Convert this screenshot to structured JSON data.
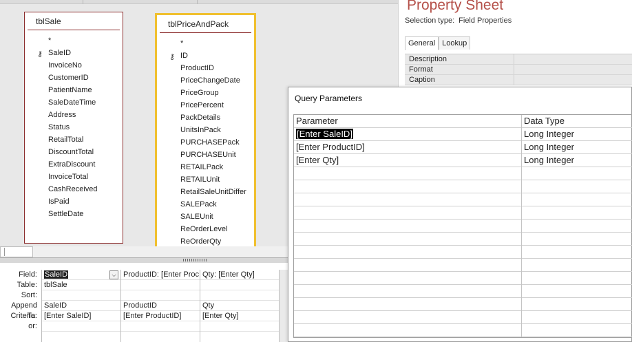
{
  "tables": [
    {
      "title": "tblSale",
      "key_field": "SaleID",
      "fields": [
        "*",
        "SaleID",
        "InvoiceNo",
        "CustomerID",
        "PatientName",
        "SaleDateTime",
        "Address",
        "Status",
        "RetailTotal",
        "DiscountTotal",
        "ExtraDiscount",
        "InvoiceTotal",
        "CashReceived",
        "IsPaid",
        "SettleDate"
      ]
    },
    {
      "title": "tblPriceAndPack",
      "key_field": "ID",
      "fields": [
        "*",
        "ID",
        "ProductID",
        "PriceChangeDate",
        "PriceGroup",
        "PricePercent",
        "PackDetails",
        "UnitsInPack",
        "PURCHASEPack",
        "PURCHASEUnit",
        "RETAILPack",
        "RETAILUnit",
        "RetailSaleUnitDiffer",
        "SALEPack",
        "SALEUnit",
        "ReOrderLevel",
        "ReOrderQty"
      ]
    }
  ],
  "qbe": {
    "row_labels": [
      "Field:",
      "Table:",
      "Sort:",
      "Append To:",
      "Criteria:",
      "or:"
    ],
    "columns": [
      {
        "field": "SaleID",
        "table": "tblSale",
        "sort": "",
        "append_to": "SaleID",
        "criteria": "[Enter SaleID]",
        "or": ""
      },
      {
        "field": "ProductID: [Enter Proc",
        "table": "",
        "sort": "",
        "append_to": "ProductID",
        "criteria": "[Enter ProductID]",
        "or": ""
      },
      {
        "field": "Qty: [Enter Qty]",
        "table": "",
        "sort": "",
        "append_to": "Qty",
        "criteria": "[Enter Qty]",
        "or": ""
      }
    ]
  },
  "property_sheet": {
    "title": "Property Sheet",
    "selection_type_label": "Selection type:",
    "selection_type_value": "Field Properties",
    "tabs": [
      "General",
      "Lookup"
    ],
    "active_tab": "General",
    "properties": [
      "Description",
      "Format",
      "Caption"
    ]
  },
  "dialog": {
    "title": "Query Parameters",
    "headers": [
      "Parameter",
      "Data Type"
    ],
    "rows": [
      {
        "parameter": "[Enter SaleID]",
        "data_type": "Long Integer"
      },
      {
        "parameter": "[Enter ProductID]",
        "data_type": "Long Integer"
      },
      {
        "parameter": "[Enter Qty]",
        "data_type": "Long Integer"
      }
    ],
    "empty_rows": 13
  },
  "colors": {
    "table_border": "#8b2c2c",
    "selected_table_border": "#f0c02f",
    "property_sheet_title": "#b5514a"
  }
}
